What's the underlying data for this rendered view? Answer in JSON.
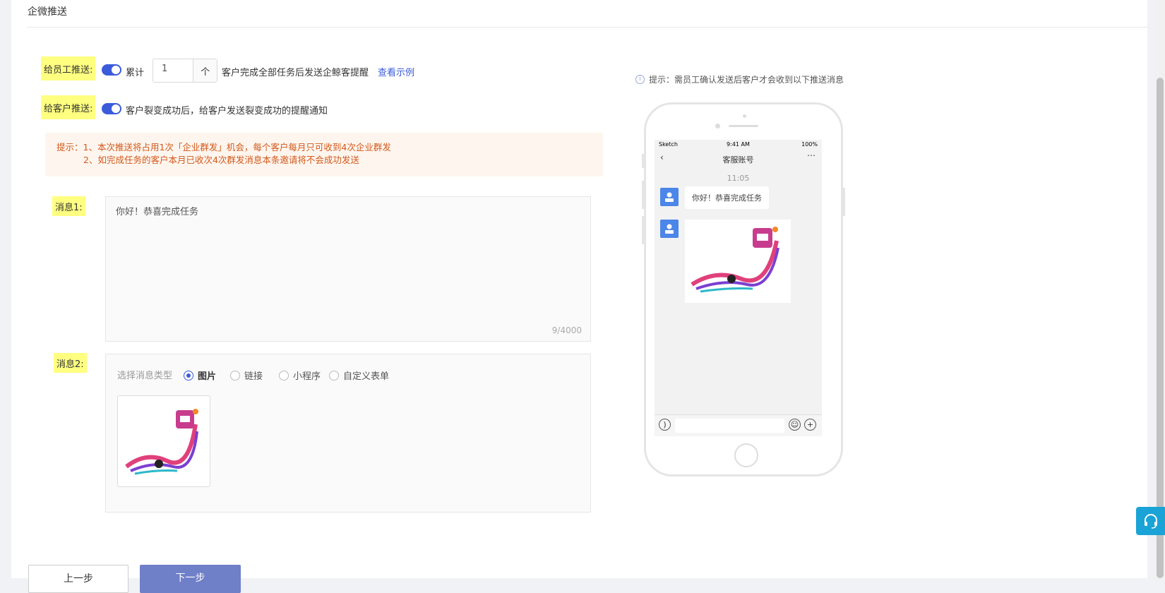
{
  "header": {
    "title": "企微推送"
  },
  "staff_push": {
    "label": "给员工推送:",
    "toggle_on": true,
    "prefix": "累计",
    "count_value": "1",
    "unit": "个",
    "suffix": "客户完成全部任务后发送企鲸客提醒",
    "example_link": "查看示例"
  },
  "customer_push": {
    "label": "给客户推送:",
    "toggle_on": true,
    "text": "客户裂变成功后，给客户发送裂变成功的提醒通知"
  },
  "tip": {
    "line1": "提示：1、本次推送将占用1次「企业群发」机会，每个客户每月只可收到4次企业群发",
    "line2": "2、如完成任务的客户本月已收次4次群发消息本条邀请将不会成功发送"
  },
  "message1": {
    "label": "消息1:",
    "content": "你好！恭喜完成任务",
    "counter": "9/4000"
  },
  "message2": {
    "label": "消息2:",
    "type_label": "选择消息类型",
    "options": [
      "图片",
      "链接",
      "小程序",
      "自定义表单"
    ],
    "selected": "图片"
  },
  "buttons": {
    "prev": "上一步",
    "next": "下一步"
  },
  "preview": {
    "tip": "提示：需员工确认发送后客户才会收到以下推送消息",
    "status_carrier": "Sketch",
    "status_time": "9:41 AM",
    "status_battery": "100%",
    "nav_title": "客服账号",
    "chat_time": "11:05",
    "bubble_text": "你好！恭喜完成任务"
  },
  "colors": {
    "accent": "#3b5bdb",
    "highlight": "#ffff80",
    "tip_bg": "#fef6ee",
    "tip_text": "#d2581c",
    "cs": "#1aa3d6"
  }
}
